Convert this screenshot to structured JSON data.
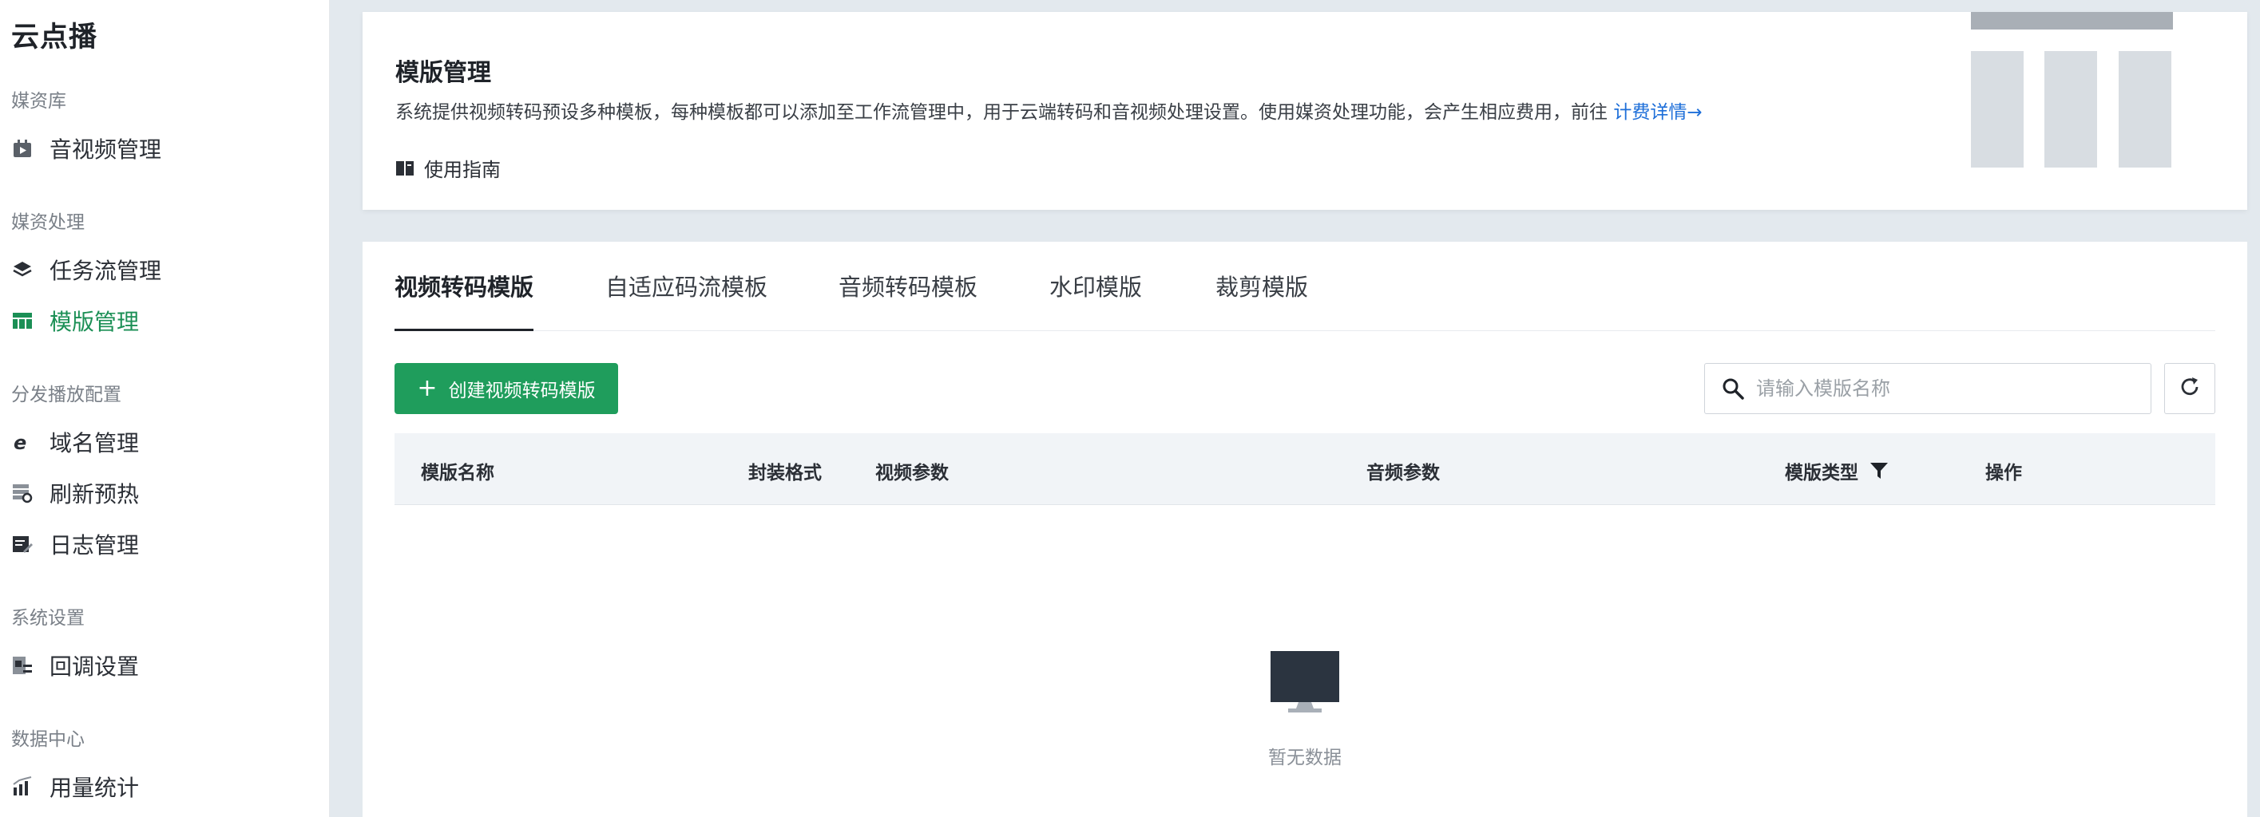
{
  "app": {
    "title": "云点播"
  },
  "sidebar": {
    "groups": [
      {
        "label": "媒资库",
        "items": [
          {
            "label": "音视频管理",
            "icon": "media-icon"
          }
        ]
      },
      {
        "label": "媒资处理",
        "items": [
          {
            "label": "任务流管理",
            "icon": "layers-icon"
          },
          {
            "label": "模版管理",
            "icon": "template-icon",
            "active": true
          }
        ]
      },
      {
        "label": "分发播放配置",
        "items": [
          {
            "label": "域名管理",
            "icon": "ie-icon"
          },
          {
            "label": "刷新预热",
            "icon": "refresh-cache-icon"
          },
          {
            "label": "日志管理",
            "icon": "log-icon"
          }
        ]
      },
      {
        "label": "系统设置",
        "items": [
          {
            "label": "回调设置",
            "icon": "callback-icon"
          }
        ]
      },
      {
        "label": "数据中心",
        "items": [
          {
            "label": "用量统计",
            "icon": "stats-icon"
          }
        ]
      }
    ]
  },
  "intro": {
    "title": "模版管理",
    "description": "系统提供视频转码预设多种模板，每种模板都可以添加至工作流管理中，用于云端转码和音视频处理设置。使用媒资处理功能，会产生相应费用，前往",
    "link": "计费详情→",
    "guide": "使用指南"
  },
  "tabs": [
    "视频转码模版",
    "自适应码流模板",
    "音频转码模板",
    "水印模版",
    "裁剪模版"
  ],
  "active_tab": 0,
  "toolbar": {
    "create_label": "创建视频转码模版",
    "search_placeholder": "请输入模版名称",
    "search_value": ""
  },
  "table": {
    "columns": [
      "模版名称",
      "封装格式",
      "视频参数",
      "音频参数",
      "模版类型",
      "操作"
    ],
    "rows": [],
    "empty_text": "暂无数据"
  },
  "colors": {
    "accent": "#1f9d5c",
    "active_nav": "#1b8f55",
    "link": "#1e6fd9"
  }
}
